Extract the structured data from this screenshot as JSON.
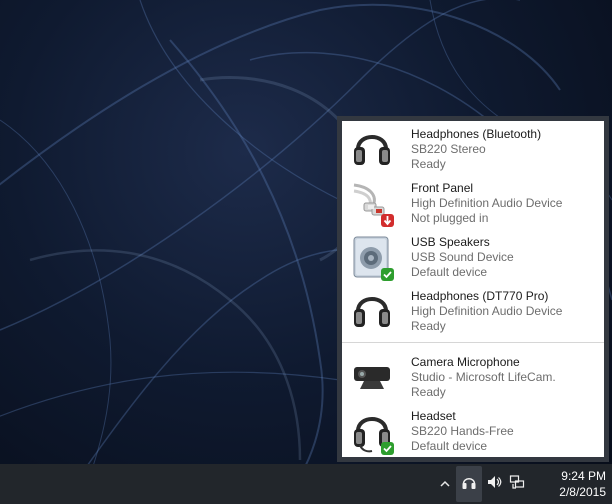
{
  "devices": [
    {
      "name": "Headphones (Bluetooth)",
      "detail": "SB220 Stereo",
      "status": "Ready",
      "icon": "headphones-icon"
    },
    {
      "name": "Front Panel",
      "detail": "High Definition Audio Device",
      "status": "Not plugged in",
      "icon": "audio-cable-icon",
      "badge": "down-arrow"
    },
    {
      "name": "USB Speakers",
      "detail": "USB Sound Device",
      "status": "Default device",
      "icon": "speaker-icon",
      "badge": "checkmark"
    },
    {
      "name": "Headphones (DT770 Pro)",
      "detail": "High Definition Audio Device",
      "status": "Ready",
      "icon": "headphones-icon"
    },
    {
      "name": "Camera Microphone",
      "detail": "Studio - Microsoft LifeCam.",
      "status": "Ready",
      "icon": "webcam-icon"
    },
    {
      "name": "Headset",
      "detail": "SB220 Hands-Free",
      "status": "Default device",
      "icon": "headset-icon",
      "badge": "checkmark"
    }
  ],
  "taskbar": {
    "time": "9:24 PM",
    "date": "2/8/2015",
    "tray_icons": [
      "chevron-up-icon",
      "headphones-icon",
      "volume-icon",
      "network-icon"
    ]
  },
  "colors": {
    "popup_border": "#333840",
    "popup_bg": "#ffffff",
    "taskbar_bg": "#22262b",
    "check_green": "#2e9e2e",
    "unplugged_red": "#d22d2d"
  }
}
